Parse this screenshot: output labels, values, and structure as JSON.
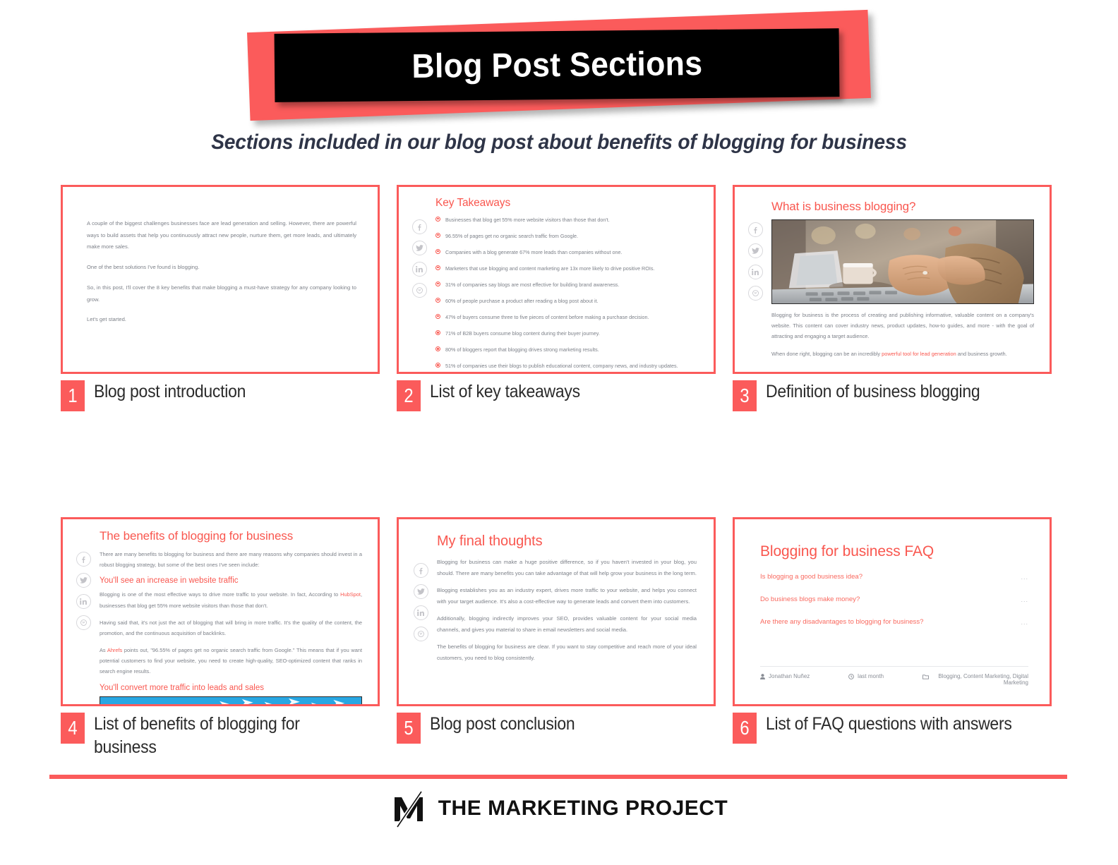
{
  "header": {
    "title": "Blog Post Sections",
    "subtitle": "Sections included in our blog post about benefits of blogging for business"
  },
  "colors": {
    "accent_red": "#FB5B5B",
    "heading_red": "#F9574F",
    "subtitle_navy": "#2E3447",
    "body_gray": "#7D8189",
    "banner_black": "#000000"
  },
  "social_icons": [
    "facebook-icon",
    "twitter-icon",
    "linkedin-icon",
    "pinterest-icon"
  ],
  "cards": [
    {
      "number": "1",
      "caption": "Blog post introduction",
      "paragraphs": [
        "A couple of the biggest challenges businesses face are lead generation and selling. However, there are powerful ways to build assets that help you continuously attract new people, nurture them, get more leads, and ultimately make more sales.",
        "One of the best solutions I've found is blogging.",
        "So, in this post, I'll cover the 8 key benefits that make blogging a must-have strategy for any company looking to grow.",
        "Let's get started."
      ]
    },
    {
      "number": "2",
      "caption": "List of key takeaways",
      "heading": "Key Takeaways",
      "bullets": [
        "Businesses that blog get 55% more website visitors than those that don't.",
        "96.55% of pages get no organic search traffic from Google.",
        "Companies with a blog generate 67% more leads than companies without one.",
        "Marketers that use blogging and content marketing are 13x more likely to drive positive ROIs.",
        "31% of companies say blogs are most effective for building brand awareness.",
        "60% of people purchase a product after reading a blog post about it.",
        "47% of buyers consume three to five pieces of content before making a purchase decision.",
        "71% of B2B buyers consume blog content during their buyer journey.",
        "80% of bloggers report that blogging drives strong marketing results.",
        "51% of companies use their blogs to publish educational content, company news, and industry updates."
      ]
    },
    {
      "number": "3",
      "caption": "Definition of business blogging",
      "heading": "What is business blogging?",
      "image_alt": "hands-typing-on-laptop-photo",
      "paragraphs": [
        "Blogging for business is the process of creating and publishing informative, valuable content on a company's website. This content can cover industry news, product updates, how-to guides, and more - with the goal of attracting and engaging a target audience.",
        "When done right, blogging can be an incredibly powerful tool for lead generation and business growth."
      ],
      "highlight_phrase": "powerful tool for lead generation"
    },
    {
      "number": "4",
      "caption": "List of benefits of blogging for business",
      "heading": "The benefits of blogging for business",
      "intro": "There are many benefits to blogging for business and there are many reasons why companies should invest in a robust blogging strategy, but some of the best ones I've seen include:",
      "subheading_1": "You'll see an increase in website traffic",
      "body_1": "Blogging is one of the most effective ways to drive more traffic to your website. In fact, According to HubSpot, businesses that blog get 55% more website visitors than those that don't.",
      "body_2": "Having said that, it's not just the act of blogging that will bring in more traffic. It's the quality of the content, the promotion, and the continuous acquisition of backlinks.",
      "body_3": "As Ahrefs points out, \"96.55% of pages get no organic search traffic from Google.\" This means that if you want potential customers to find your website, you need to create high-quality, SEO-optimized content that ranks in search engine results.",
      "subheading_2": "You'll convert more traffic into leads and sales",
      "image_alt": "red-magnet-attracting-paper-arrows-photo",
      "links": [
        "HubSpot",
        "Ahrefs"
      ]
    },
    {
      "number": "5",
      "caption": "Blog post conclusion",
      "heading": "My final thoughts",
      "paragraphs": [
        "Blogging for business can make a huge positive difference, so if you haven't invested in your blog, you should. There are many benefits you can take advantage of that will help grow your business in the long term.",
        "Blogging establishes you as an industry expert, drives more traffic to your website, and helps you connect with your target audience. It's also a cost-effective way to generate leads and convert them into customers.",
        "Additionally, blogging indirectly improves your SEO, provides valuable content for your social media channels, and gives you material to share in email newsletters and social media.",
        "The benefits of blogging for business are clear. If you want to stay competitive and reach more of your ideal customers, you need to blog consistently."
      ]
    },
    {
      "number": "6",
      "caption": "List of FAQ questions with answers",
      "heading": "Blogging for business FAQ",
      "questions": [
        "Is blogging a good business idea?",
        "Do business blogs make money?",
        "Are there any disadvantages to blogging for business?"
      ],
      "expand_glyph": "...",
      "meta": {
        "author": "Jonathan Nuñez",
        "date": "last month",
        "categories": "Blogging, Content Marketing, Digital Marketing"
      }
    }
  ],
  "footer": {
    "brand": "THE MARKETING PROJECT",
    "logo_alt": "m-slash-logo"
  }
}
